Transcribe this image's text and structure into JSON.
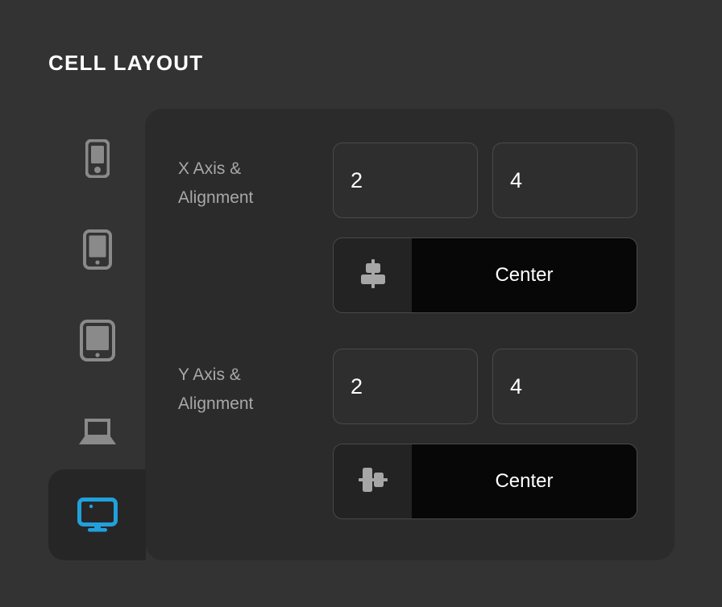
{
  "section": {
    "title": "CELL LAYOUT"
  },
  "device_rail": {
    "items": [
      {
        "name": "mobile-small",
        "icon": "phone-small-icon",
        "selected": false
      },
      {
        "name": "mobile-large",
        "icon": "phone-large-icon",
        "selected": false
      },
      {
        "name": "tablet",
        "icon": "tablet-icon",
        "selected": false
      },
      {
        "name": "laptop",
        "icon": "laptop-icon",
        "selected": false
      },
      {
        "name": "desktop",
        "icon": "desktop-icon",
        "selected": true
      }
    ]
  },
  "rows": [
    {
      "label": "X Axis &\nAlignment",
      "start_value": "2",
      "end_value": "4",
      "alignment_icon": "align-center-horizontal-icon",
      "alignment_value": "Center"
    },
    {
      "label": "Y Axis &\nAlignment",
      "start_value": "2",
      "end_value": "4",
      "alignment_icon": "align-center-vertical-icon",
      "alignment_value": "Center"
    }
  ],
  "colors": {
    "page_background": "#333333",
    "panel_background": "#2b2b2b",
    "selected_tile_background": "#262626",
    "accent": "#22a0db",
    "icon_inactive": "#8a8a8a",
    "label_text": "#a8a8a8",
    "value_text": "#ffffff",
    "field_background": "#2e2e2e",
    "field_border": "#4a4a4a",
    "segment_icon_background": "#232323",
    "segment_value_background": "#070707"
  }
}
